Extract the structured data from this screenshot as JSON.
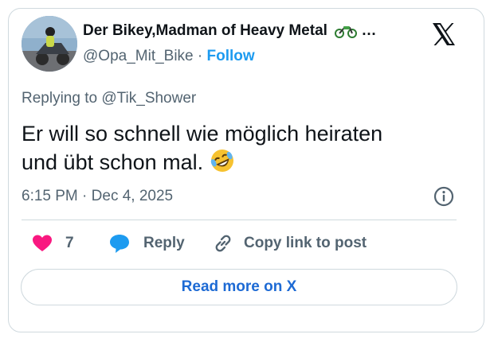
{
  "author": {
    "display_name": "Der Bikey,Madman of Heavy Metal",
    "name_suffix": "…",
    "handle": "@Opa_Mit_Bike",
    "separator": "·",
    "follow_label": "Follow"
  },
  "reply_context": {
    "prefix": "Replying to",
    "handle": "@Tik_Shower"
  },
  "tweet": {
    "text_line1": "Er will so schnell wie möglich heiraten",
    "text_line2": "und übt schon mal.",
    "emoji_icon": "rolling-on-floor-laughing-emoji"
  },
  "timestamp": {
    "time": "6:15 PM",
    "separator": "·",
    "date": "Dec 4, 2025"
  },
  "actions": {
    "like_count": "7",
    "reply_label": "Reply",
    "copy_link_label": "Copy link to post"
  },
  "read_more_label": "Read more on X",
  "colors": {
    "accent": "#1d9bf0",
    "like": "#f91880",
    "text_primary": "#0f1419",
    "text_secondary": "#536471",
    "border": "#cfd9de"
  }
}
